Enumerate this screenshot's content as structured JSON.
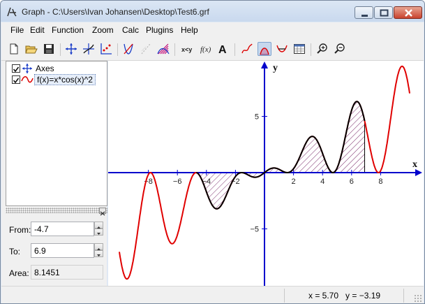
{
  "window": {
    "title": "Graph - C:\\Users\\Ivan Johansen\\Desktop\\Test6.grf"
  },
  "menu": [
    "File",
    "Edit",
    "Function",
    "Zoom",
    "Calc",
    "Plugins",
    "Help"
  ],
  "toolbar": [
    "new-icon",
    "open-icon",
    "save-icon",
    "axes-icon",
    "insert-function-icon",
    "insert-point-series-icon",
    "insert-tangent-icon",
    "insert-relation-icon",
    "insert-shading-icon",
    "evaluate-xy-icon",
    "evaluate-fx-icon",
    "insert-label-icon",
    "trace-icon",
    "area-icon",
    "path-length-icon",
    "table-icon",
    "zoom-in-icon",
    "zoom-out-icon"
  ],
  "tree": {
    "items": [
      {
        "label": "Axes",
        "checked": true,
        "icon": "axes-icon"
      },
      {
        "label": "f(x)=x*cos(x)^2",
        "checked": true,
        "icon": "function-curve-icon"
      }
    ]
  },
  "calc": {
    "from_label": "From:",
    "from_value": "-4.7",
    "to_label": "To:",
    "to_value": "6.9",
    "area_label": "Area:",
    "area_value": "8.1451"
  },
  "status": {
    "x": "x = 5.70",
    "y": "y = −3.19"
  },
  "colors": {
    "axis": "#0000cc",
    "curve": "#e00000",
    "highlight": "#000000",
    "shade": "#7b2d6b"
  },
  "chart_data": {
    "type": "line",
    "function": "x*cos(x)^2",
    "xlabel": "x",
    "ylabel": "y",
    "xlim": [
      -10,
      10
    ],
    "ylim": [
      -10,
      10
    ],
    "x_ticks": [
      -8,
      -6,
      -4,
      -2,
      2,
      4,
      6,
      8
    ],
    "y_ticks": [
      5,
      -5
    ],
    "area_from": -4.7,
    "area_to": 6.9,
    "area": 8.1451,
    "series": [
      {
        "x": [
          -10,
          -9.8,
          -9.6,
          -9.4,
          -9.2,
          -9,
          -8.8,
          -8.6,
          -8.4,
          -8.2,
          -8,
          -7.8,
          -7.6,
          -7.4,
          -7.2,
          -7,
          -6.8,
          -6.6,
          -6.4,
          -6.2,
          -6,
          -5.8,
          -5.6,
          -5.4,
          -5.2,
          -5,
          -4.8,
          -4.6,
          -4.4,
          -4.2,
          -4,
          -3.8,
          -3.6,
          -3.4,
          -3.2,
          -3,
          -2.8,
          -2.6,
          -2.4,
          -2.2,
          -2,
          -1.8,
          -1.6,
          -1.4,
          -1.2,
          -1,
          -0.8,
          -0.6,
          -0.4,
          -0.2,
          0,
          0.2,
          0.4,
          0.6,
          0.8,
          1,
          1.2,
          1.4,
          1.6,
          1.8,
          2,
          2.2,
          2.4,
          2.6,
          2.8,
          3,
          3.2,
          3.4,
          3.6,
          3.8,
          4,
          4.2,
          4.4,
          4.6,
          4.8,
          5,
          5.2,
          5.4,
          5.6,
          5.8,
          6,
          6.2,
          6.4,
          6.6,
          6.8,
          7,
          7.2,
          7.4,
          7.6,
          7.8,
          8,
          8.2,
          8.4,
          8.6,
          8.8,
          9,
          9.2,
          9.4,
          9.6,
          9.8,
          10
        ],
        "values": [
          -7.04,
          -8.7,
          -9.53,
          -9.35,
          -8.22,
          -7.52,
          -5.74,
          -3.88,
          -2.24,
          -1.04,
          -0.17,
          -0.06,
          -0.63,
          -1.69,
          -2.94,
          -3.99,
          -4.78,
          -5.22,
          -5.21,
          -4.94,
          -5.08,
          -4.66,
          -3.43,
          -2.44,
          -1.2,
          -0.4,
          -0.04,
          -0.06,
          -0.42,
          -1.04,
          -1.71,
          -2.33,
          -2.82,
          -3.15,
          -3.2,
          -2.94,
          -2.46,
          -1.91,
          -1.3,
          -0.74,
          -0.35,
          -0.09,
          0,
          -0.04,
          -0.16,
          -0.29,
          -0.39,
          -0.41,
          -0.34,
          -0.19,
          0,
          0.19,
          0.34,
          0.41,
          0.39,
          0.29,
          0.16,
          0.04,
          0,
          0.09,
          0.35,
          0.74,
          1.3,
          1.91,
          2.46,
          2.94,
          3.2,
          3.15,
          2.82,
          2.33,
          1.71,
          1.04,
          0.42,
          0.06,
          0.04,
          0.4,
          1.2,
          2.44,
          3.43,
          4.66,
          5.08,
          4.94,
          5.21,
          5.22,
          4.78,
          3.99,
          2.94,
          1.69,
          0.63,
          0.06,
          0.17,
          1.04,
          2.24,
          3.88,
          5.74,
          7.52,
          8.22,
          9.35,
          9.53,
          8.7,
          7.04
        ]
      }
    ]
  }
}
